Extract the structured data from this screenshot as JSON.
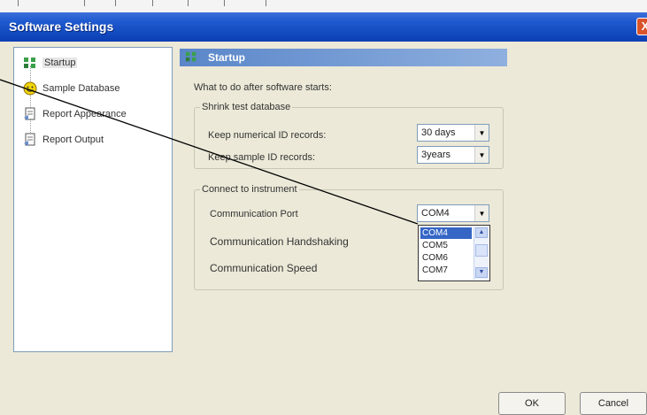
{
  "window": {
    "title": "Software Settings",
    "close_glyph": "X"
  },
  "nav": {
    "items": [
      {
        "label": "Startup",
        "icon": "startup-icon"
      },
      {
        "label": "Sample Database",
        "icon": "database-smiley-icon"
      },
      {
        "label": "Report Appearance",
        "icon": "report-icon"
      },
      {
        "label": "Report Output",
        "icon": "report-icon"
      }
    ],
    "selected": "Startup"
  },
  "content": {
    "header_title": "Startup",
    "intro": "What to do after software starts:",
    "shrink_group": {
      "legend": "Shrink test database",
      "numerical_label": "Keep numerical ID records:",
      "numerical_value": "30 days",
      "sample_label": "Keep sample ID records:",
      "sample_value": "3years"
    },
    "connect_group": {
      "legend": "Connect to instrument",
      "port_label": "Communication Port",
      "port_value": "COM4",
      "handshake_label": "Communication Handshaking",
      "speed_label": "Communication Speed"
    },
    "port_options": [
      "COM4",
      "COM5",
      "COM6",
      "COM7"
    ],
    "port_selected": "COM4"
  },
  "buttons": {
    "ok": "OK",
    "cancel": "Cancel"
  },
  "colors": {
    "title_bar": "#1f5ad0",
    "header_bar": "#5a86c9",
    "selection": "#3566c6",
    "dialog_bg": "#ece9d8"
  }
}
